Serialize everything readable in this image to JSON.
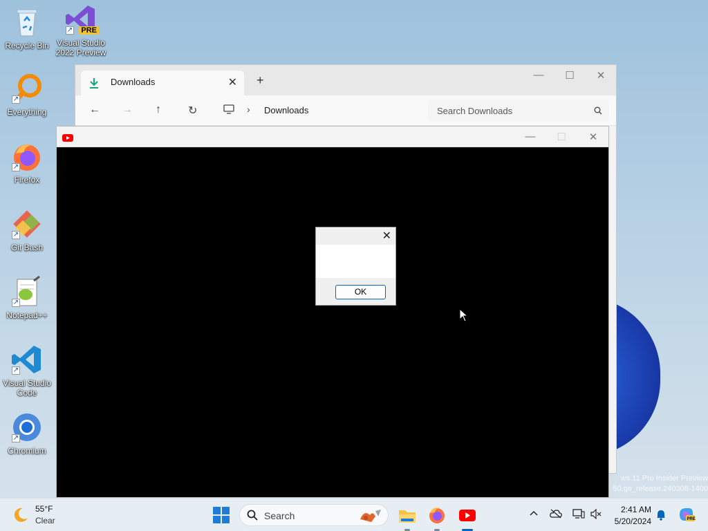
{
  "desktop": {
    "icons": [
      {
        "label": "Recycle Bin",
        "icon": "recycle-bin-icon"
      },
      {
        "label": "Visual Studio 2022 Preview",
        "icon": "visual-studio-preview-icon",
        "badge": "PRE"
      },
      {
        "label": "Everything",
        "icon": "everything-search-icon"
      },
      {
        "label": "Firefox",
        "icon": "firefox-icon"
      },
      {
        "label": "Git Bash",
        "icon": "git-bash-icon"
      },
      {
        "label": "Notepad++",
        "icon": "notepad-plus-plus-icon"
      },
      {
        "label": "Visual Studio Code",
        "icon": "vscode-icon"
      },
      {
        "label": "Chromium",
        "icon": "chromium-icon"
      }
    ]
  },
  "explorer": {
    "tab_title": "Downloads",
    "tab_close": "✕",
    "new_tab": "+",
    "minimize": "—",
    "maximize": "☐",
    "close": "✕",
    "nav": {
      "back": "←",
      "forward": "→",
      "up": "↑",
      "refresh": "↻"
    },
    "breadcrumb_chevron": "›",
    "breadcrumb": "Downloads",
    "search_placeholder": "Search Downloads"
  },
  "youtube_window": {
    "minimize": "—",
    "maximize": "☐",
    "close": "✕"
  },
  "dialog": {
    "close": "✕",
    "ok_label": "OK"
  },
  "watermark": {
    "line1": "ws 11 Pro Insider Preview",
    "line2": "50.ge_release.240308-1400"
  },
  "taskbar": {
    "weather_temp": "55°F",
    "weather_desc": "Clear",
    "search_label": "Search",
    "clock_time": "2:41 AM",
    "clock_date": "5/20/2024",
    "apps": [
      {
        "name": "file-explorer",
        "active": false
      },
      {
        "name": "firefox",
        "active": false
      },
      {
        "name": "youtube",
        "active": true
      }
    ]
  },
  "colors": {
    "accent": "#0067c0",
    "youtube_red": "#ff0000",
    "taskbar_bg": "#e6eef4"
  }
}
